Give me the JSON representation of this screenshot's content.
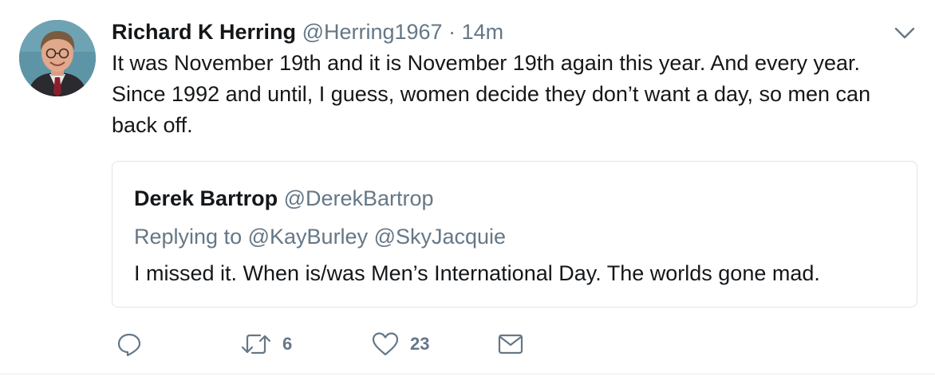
{
  "tweet": {
    "author_name": "Richard K Herring",
    "author_handle": "@Herring1967",
    "separator": "·",
    "timestamp": "14m",
    "text": "It was November 19th and it is November 19th again this year. And every year. Since 1992 and until, I guess, women decide they don’t want a day, so men can back off.",
    "avatar_icon": "user-avatar-photo",
    "menu_icon": "chevron-down-icon"
  },
  "quoted_tweet": {
    "author_name": "Derek Bartrop",
    "author_handle": "@DerekBartrop",
    "replying_label": "Replying to",
    "replying_to": "@KayBurley @SkyJacquie",
    "text": "I missed it. When is/was Men’s International Day. The worlds gone mad."
  },
  "actions": {
    "reply": {
      "icon": "reply-icon",
      "count": ""
    },
    "retweet": {
      "icon": "retweet-icon",
      "count": "6"
    },
    "like": {
      "icon": "heart-icon",
      "count": "23"
    },
    "dm": {
      "icon": "envelope-icon"
    }
  },
  "colors": {
    "text": "#14171a",
    "secondary": "#657786",
    "border": "#dfe4e8"
  }
}
